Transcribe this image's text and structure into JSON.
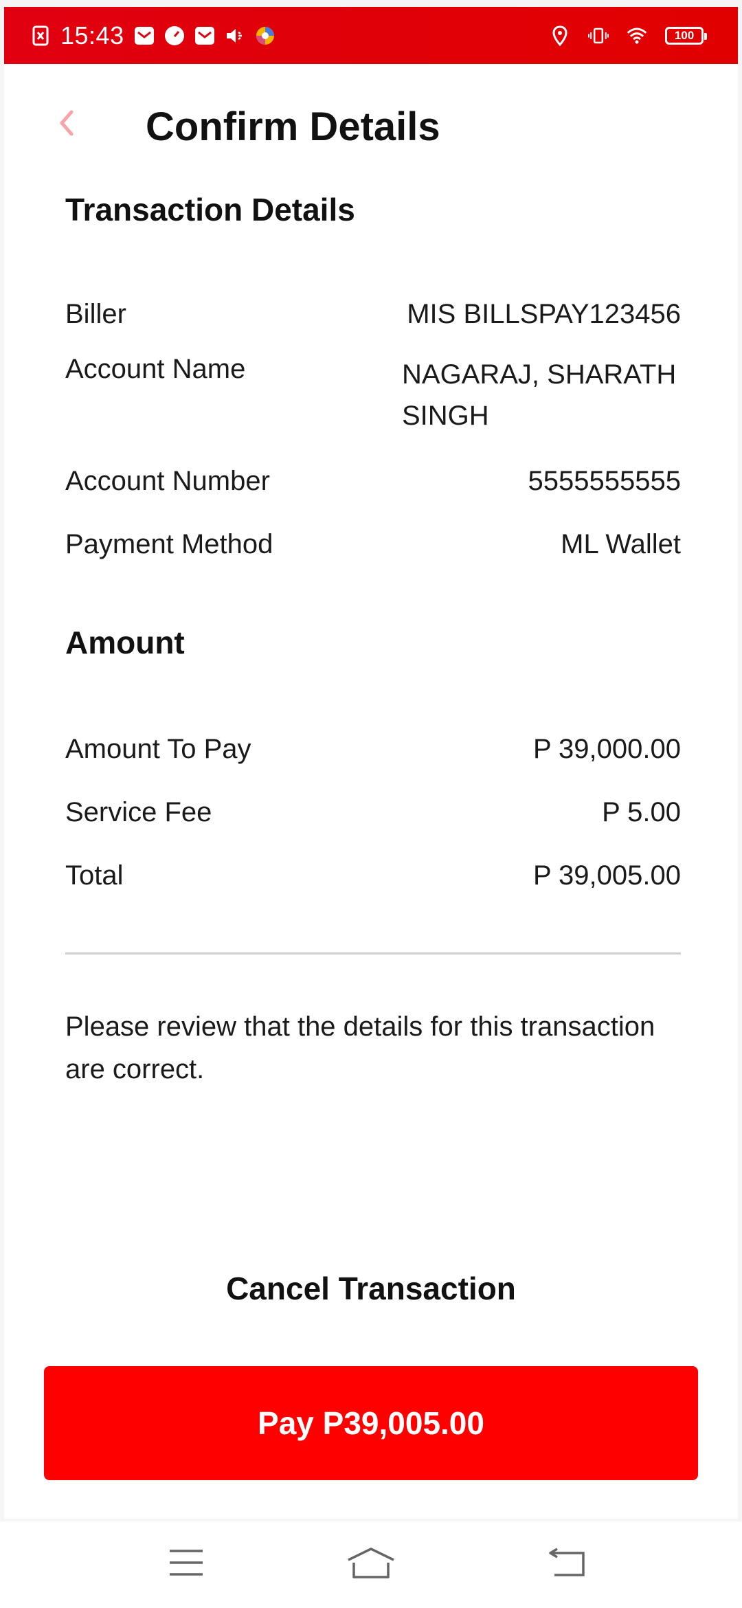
{
  "status_bar": {
    "time": "15:43",
    "battery": "100",
    "left_icons": [
      "sim-off-icon",
      "mail-icon",
      "speedometer-icon",
      "mail-icon",
      "mute-icon",
      "browser-icon"
    ],
    "right_icons": [
      "location-icon",
      "vibrate-icon",
      "wifi-icon",
      "battery-icon"
    ]
  },
  "header": {
    "title": "Confirm Details",
    "back_icon": "chevron-left-icon"
  },
  "transaction": {
    "section_title": "Transaction Details",
    "rows": [
      {
        "label": "Biller",
        "value": "MIS BILLSPAY123456"
      },
      {
        "label": "Account Name",
        "value": "NAGARAJ, SHARATH SINGH"
      },
      {
        "label": "Account Number",
        "value": "5555555555"
      },
      {
        "label": "Payment Method",
        "value": "ML Wallet"
      }
    ]
  },
  "amount": {
    "section_title": "Amount",
    "rows": [
      {
        "label": "Amount To Pay",
        "value": "P 39,000.00"
      },
      {
        "label": "Service Fee",
        "value": "P 5.00"
      },
      {
        "label": "Total",
        "value": "P 39,005.00"
      }
    ]
  },
  "review_note": "Please review that the details for this transaction are correct.",
  "actions": {
    "cancel_label": "Cancel Transaction",
    "pay_label": "Pay P39,005.00"
  },
  "nav_bar": {
    "items": [
      "menu-icon",
      "home-icon",
      "back-icon"
    ]
  },
  "colors": {
    "brand_red": "#ff0000",
    "status_bar_red": "#e00010",
    "back_chevron": "#f7a3a8"
  }
}
